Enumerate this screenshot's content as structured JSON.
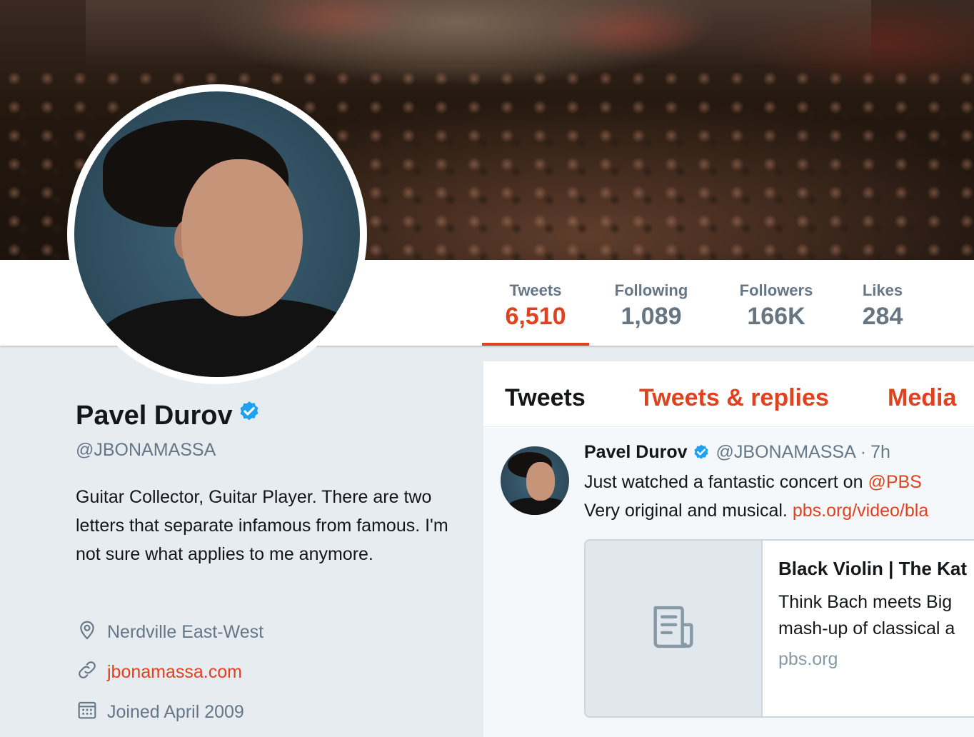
{
  "profile": {
    "name": "Pavel Durov",
    "handle": "@JBONAMASSA",
    "bio": "Guitar Collector, Guitar Player. There are two letters that separate infamous from famous. I'm not sure what applies to me anymore.",
    "location": "Nerdville East-West",
    "website": "jbonamassa.com",
    "joined": "Joined April 2009",
    "verified_icon": "verified-badge-icon"
  },
  "stats": [
    {
      "label": "Tweets",
      "value": "6,510",
      "active": true
    },
    {
      "label": "Following",
      "value": "1,089",
      "active": false
    },
    {
      "label": "Followers",
      "value": "166K",
      "active": false
    },
    {
      "label": "Likes",
      "value": "284",
      "active": false
    }
  ],
  "tabs": [
    {
      "label": "Tweets",
      "active": true
    },
    {
      "label": "Tweets & replies",
      "active": false
    },
    {
      "label": "Media",
      "active": false
    }
  ],
  "tweet": {
    "name": "Pavel Durov",
    "handle": "@JBONAMASSA",
    "separator": "·",
    "time": "7h",
    "text_line1": "Just watched a fantastic concert on ",
    "mention": "@PBS",
    "text_line2": "Very original and musical. ",
    "url": "pbs.org/video/bla",
    "card": {
      "title": "Black Violin | The Kat",
      "desc_line1": "Think Bach meets Big",
      "desc_line2": "mash-up of classical a",
      "domain": "pbs.org"
    }
  },
  "colors": {
    "accent": "#e0411e",
    "verified": "#1da1f2",
    "muted_text": "#657786",
    "page_bg": "#e6ecf0"
  }
}
